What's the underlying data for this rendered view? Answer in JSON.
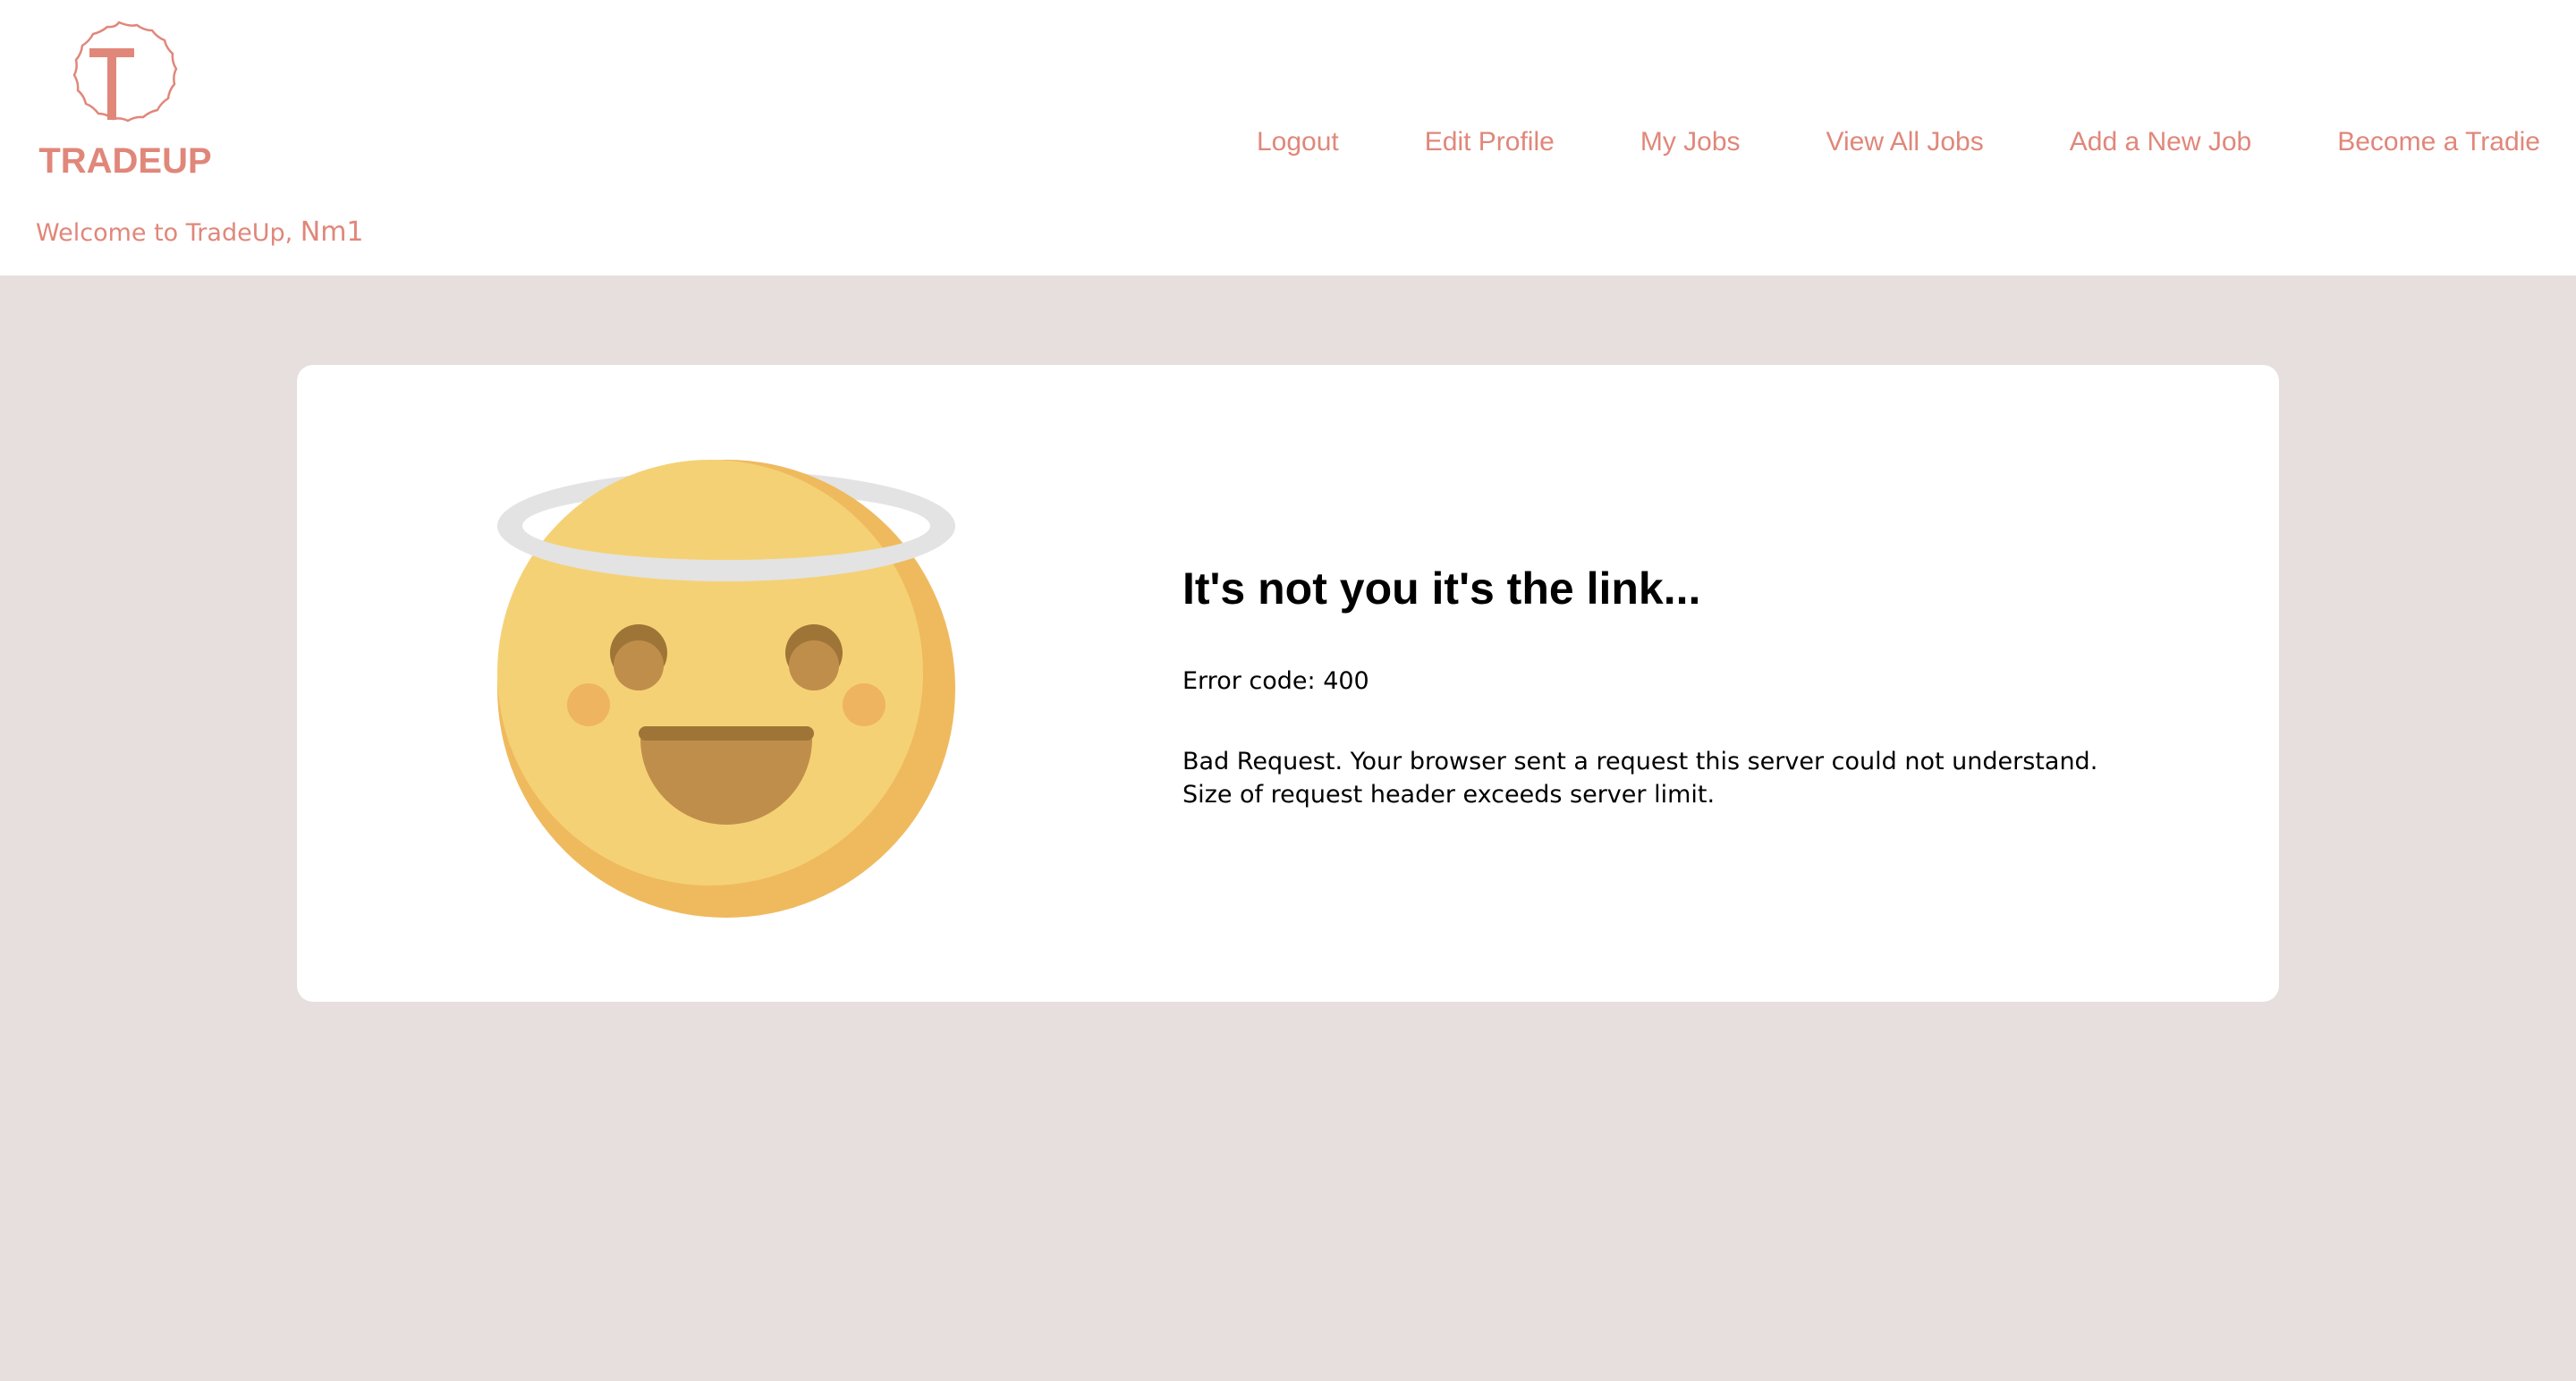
{
  "app": {
    "brand_name": "TRADEUP",
    "logo_letter": "T",
    "brand_color": "#e0877a",
    "page_background": "#e7dfde"
  },
  "header": {
    "welcome_prefix": "Welcome to TradeUp, ",
    "username": "Nm1"
  },
  "nav": {
    "items": [
      {
        "label": "Logout"
      },
      {
        "label": "Edit Profile"
      },
      {
        "label": "My Jobs"
      },
      {
        "label": "View All Jobs"
      },
      {
        "label": "Add a New Job"
      },
      {
        "label": "Become a Tradie"
      }
    ]
  },
  "error": {
    "illustration_icon": "smiling-face-with-halo-icon",
    "title": "It's not you it's the link...",
    "code_label": "Error code: 400",
    "description_line1": "Bad Request. Your browser sent a request this server could not understand.",
    "description_line2": "Size of request header exceeds server limit."
  }
}
